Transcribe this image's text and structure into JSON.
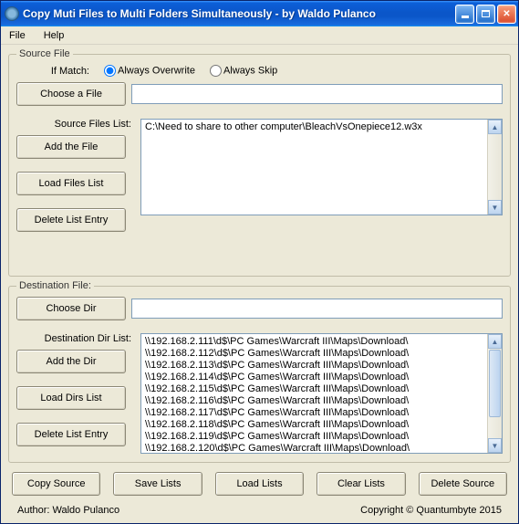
{
  "titlebar": {
    "title": "Copy Muti Files to Multi Folders Simultaneously - by Waldo Pulanco"
  },
  "menu": {
    "file": "File",
    "help": "Help"
  },
  "source": {
    "legend": "Source File",
    "if_match": "If Match:",
    "opt_overwrite": "Always Overwrite",
    "opt_skip": "Always Skip",
    "choose_file": "Choose a File",
    "file_value": "",
    "list_label": "Source Files List:",
    "add": "Add the File",
    "load": "Load Files List",
    "delete": "Delete List Entry",
    "items": [
      "C:\\Need to share to other computer\\BleachVsOnepiece12.w3x"
    ]
  },
  "dest": {
    "legend": "Destination File:",
    "choose_dir": "Choose Dir",
    "dir_value": "",
    "list_label": "Destination Dir List:",
    "add": "Add the Dir",
    "load": "Load Dirs List",
    "delete": "Delete List Entry",
    "items": [
      "\\\\192.168.2.111\\d$\\PC Games\\Warcraft III\\Maps\\Download\\",
      "\\\\192.168.2.112\\d$\\PC Games\\Warcraft III\\Maps\\Download\\",
      "\\\\192.168.2.113\\d$\\PC Games\\Warcraft III\\Maps\\Download\\",
      "\\\\192.168.2.114\\d$\\PC Games\\Warcraft III\\Maps\\Download\\",
      "\\\\192.168.2.115\\d$\\PC Games\\Warcraft III\\Maps\\Download\\",
      "\\\\192.168.2.116\\d$\\PC Games\\Warcraft III\\Maps\\Download\\",
      "\\\\192.168.2.117\\d$\\PC Games\\Warcraft III\\Maps\\Download\\",
      "\\\\192.168.2.118\\d$\\PC Games\\Warcraft III\\Maps\\Download\\",
      "\\\\192.168.2.119\\d$\\PC Games\\Warcraft III\\Maps\\Download\\",
      "\\\\192.168.2.120\\d$\\PC Games\\Warcraft III\\Maps\\Download\\"
    ]
  },
  "bottom": {
    "copy": "Copy Source",
    "save": "Save Lists",
    "load": "Load Lists",
    "clear": "Clear Lists",
    "delete": "Delete Source"
  },
  "status": {
    "author": "Author: Waldo Pulanco",
    "copyright": "Copyright © Quantumbyte 2015"
  }
}
